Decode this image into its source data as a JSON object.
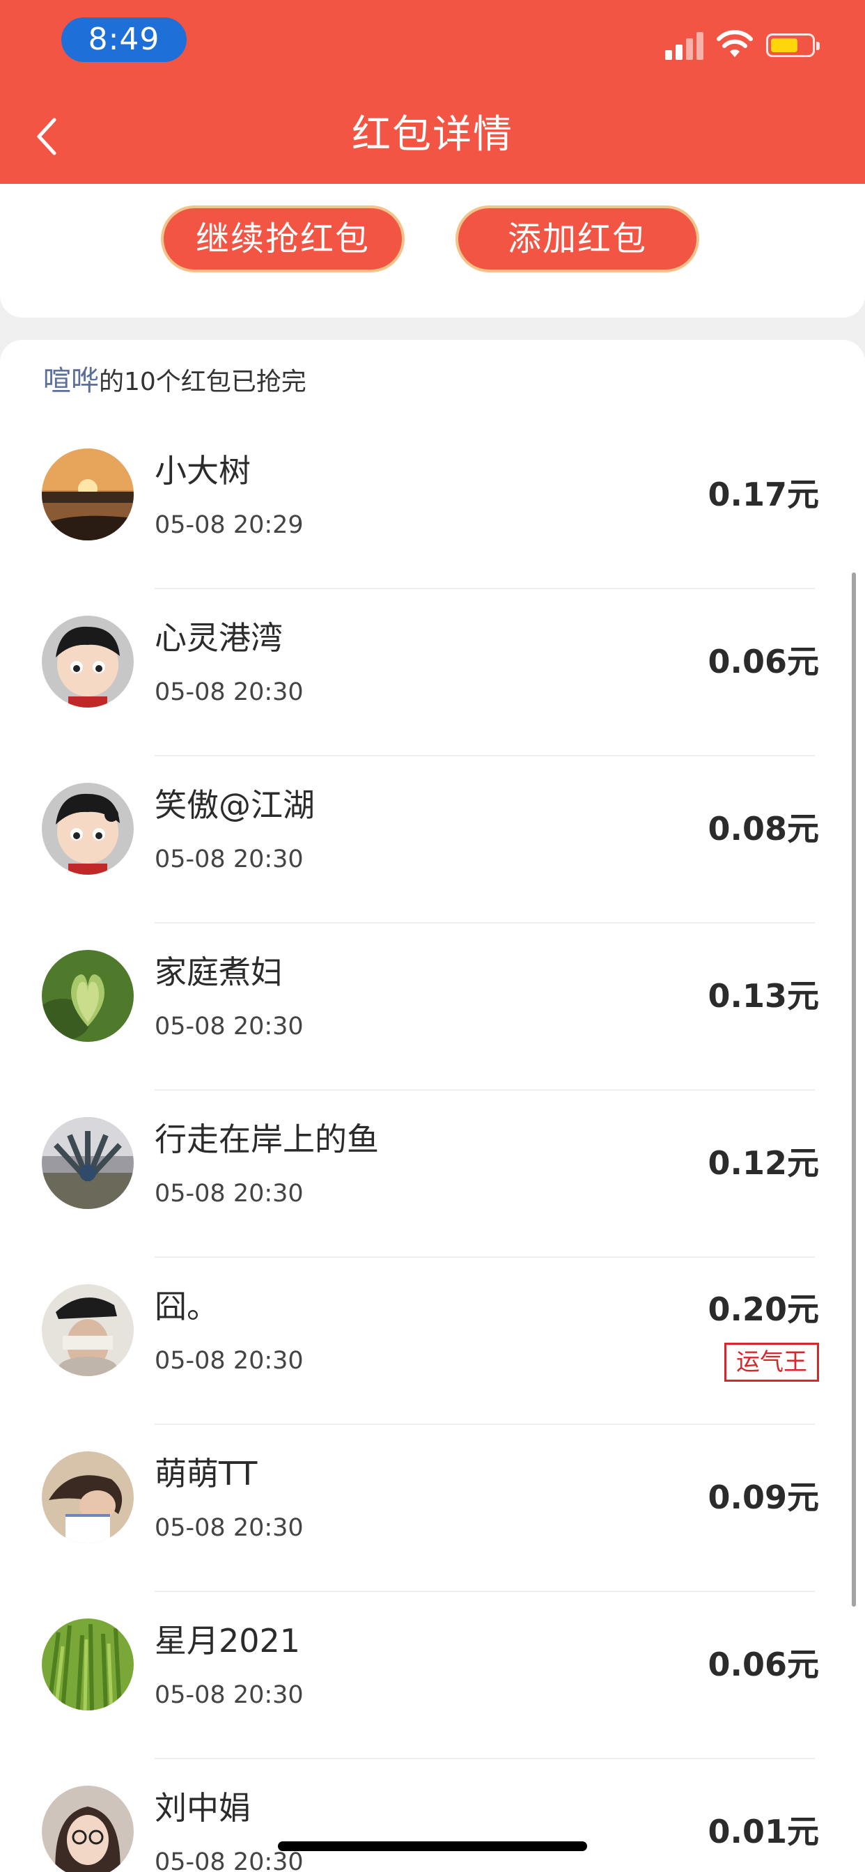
{
  "status_bar": {
    "time": "8:49"
  },
  "nav": {
    "title": "红包详情"
  },
  "actions": {
    "continue_label": "继续抢红包",
    "add_label": "添加红包"
  },
  "summary": {
    "sender": "喧哗",
    "text": "的10个红包已抢完"
  },
  "list": [
    {
      "name": "小大树",
      "time": "05-08 20:29",
      "amount": "0.17元"
    },
    {
      "name": "心灵港湾",
      "time": "05-08 20:30",
      "amount": "0.06元"
    },
    {
      "name": "笑傲@江湖",
      "time": "05-08 20:30",
      "amount": "0.08元"
    },
    {
      "name": "家庭煮妇",
      "time": "05-08 20:30",
      "amount": "0.13元"
    },
    {
      "name": "行走在岸上的鱼",
      "time": "05-08 20:30",
      "amount": "0.12元"
    },
    {
      "name": "囧。",
      "time": "05-08 20:30",
      "amount": "0.20元",
      "badge": "运气王"
    },
    {
      "name": "萌萌TT",
      "time": "05-08 20:30",
      "amount": "0.09元"
    },
    {
      "name": "星月2021",
      "time": "05-08 20:30",
      "amount": "0.06元"
    },
    {
      "name": "刘中娟",
      "time": "05-08 20:30",
      "amount": "0.01元"
    }
  ],
  "colors": {
    "header": "#f25544",
    "button_border": "#f4c38a",
    "sender_name": "#5a6f9a",
    "luck_badge": "#d9262a",
    "time_pill": "#1f6fd8"
  }
}
